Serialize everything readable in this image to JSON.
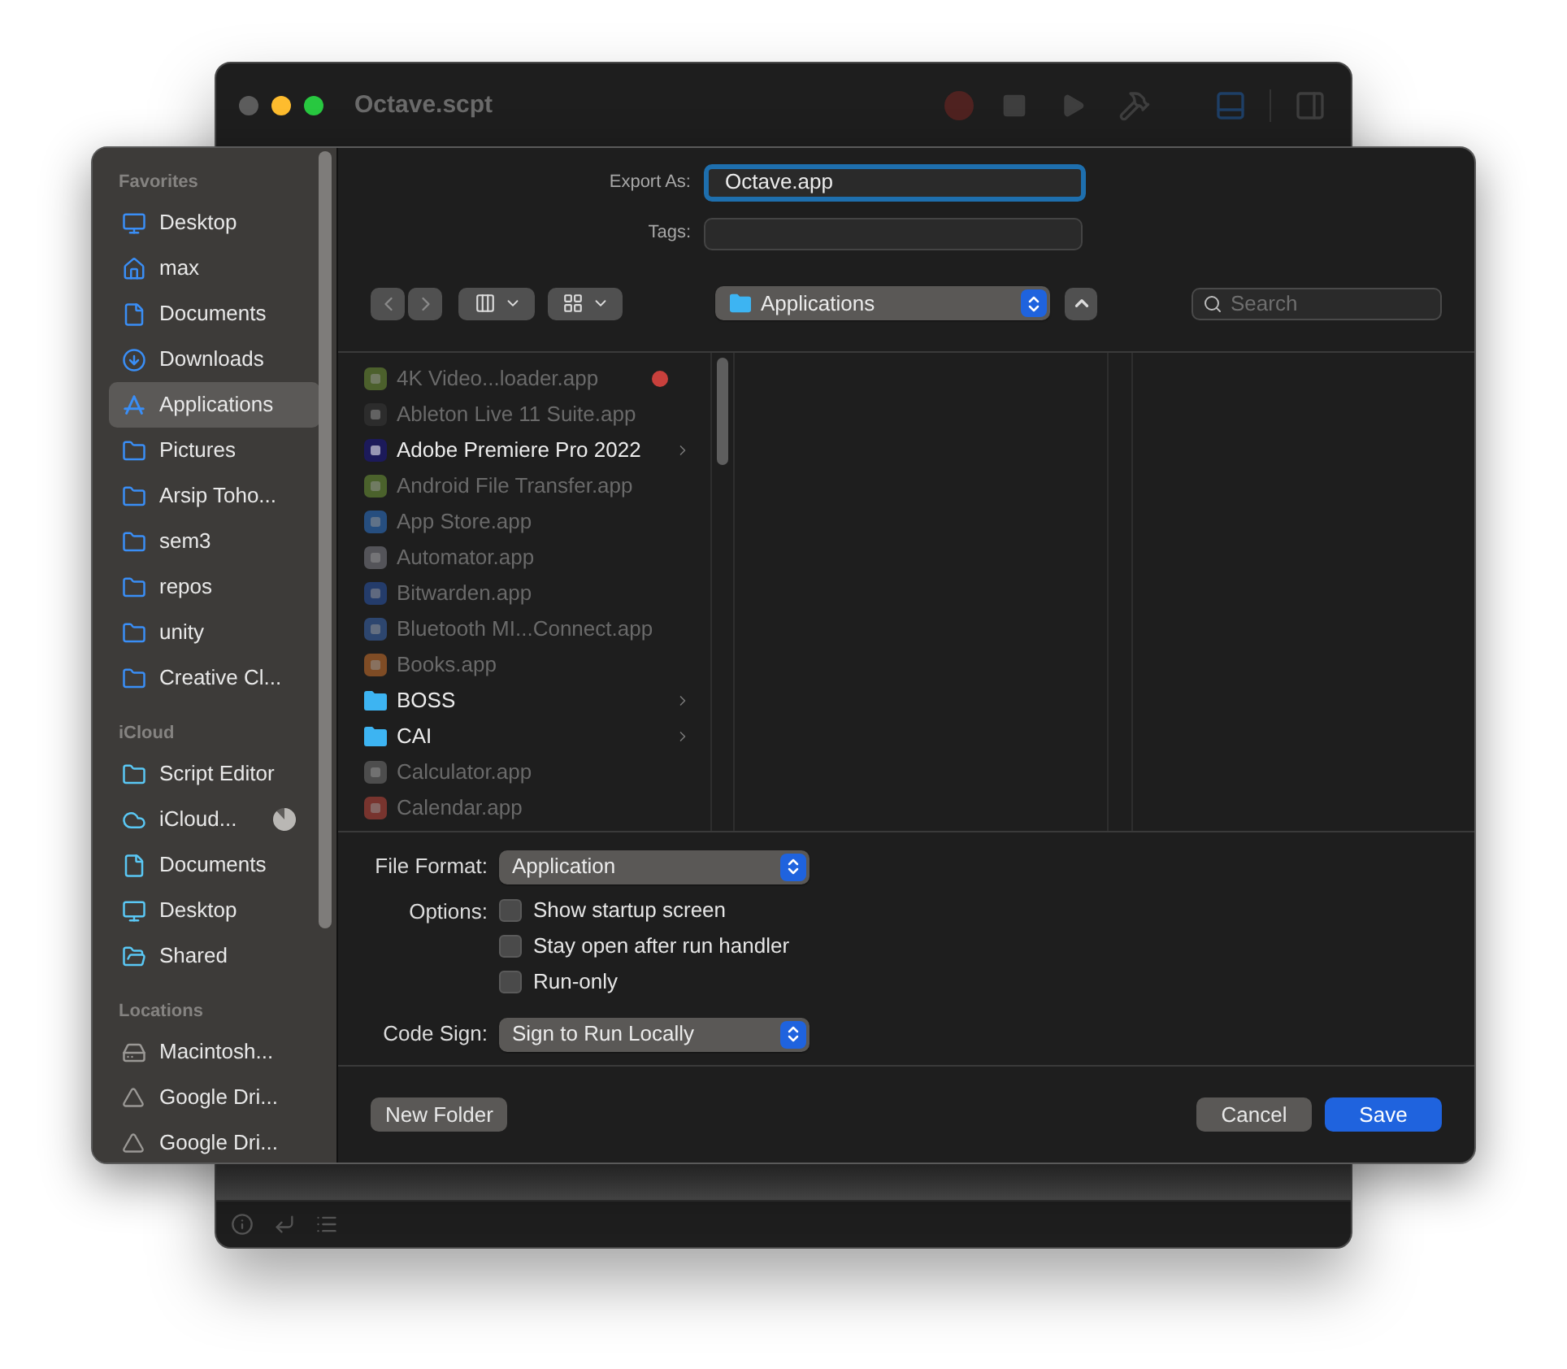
{
  "window": {
    "title": "Octave.scpt"
  },
  "sidebar": {
    "sections": [
      {
        "title": "Favorites",
        "items": [
          {
            "label": "Desktop",
            "kind": "desktop",
            "selected": false
          },
          {
            "label": "max",
            "kind": "home",
            "selected": false
          },
          {
            "label": "Documents",
            "kind": "document",
            "selected": false
          },
          {
            "label": "Downloads",
            "kind": "download",
            "selected": false
          },
          {
            "label": "Applications",
            "kind": "apps",
            "selected": true
          },
          {
            "label": "Pictures",
            "kind": "folder",
            "selected": false
          },
          {
            "label": "Arsip Toho...",
            "kind": "folder",
            "selected": false
          },
          {
            "label": "sem3",
            "kind": "folder",
            "selected": false
          },
          {
            "label": "repos",
            "kind": "folder",
            "selected": false
          },
          {
            "label": "unity",
            "kind": "folder",
            "selected": false
          },
          {
            "label": "Creative Cl...",
            "kind": "folder",
            "selected": false
          }
        ]
      },
      {
        "title": "iCloud",
        "items": [
          {
            "label": "Script Editor",
            "kind": "cloud-folder",
            "selected": false
          },
          {
            "label": "iCloud...",
            "kind": "cloud",
            "selected": false,
            "level": 0.88
          },
          {
            "label": "Documents",
            "kind": "cloud-document",
            "selected": false
          },
          {
            "label": "Desktop",
            "kind": "cloud-desktop",
            "selected": false
          },
          {
            "label": "Shared",
            "kind": "shared",
            "selected": false
          }
        ]
      },
      {
        "title": "Locations",
        "items": [
          {
            "label": "Macintosh...",
            "kind": "drive",
            "selected": false
          },
          {
            "label": "Google Dri...",
            "kind": "gdrive",
            "selected": false
          },
          {
            "label": "Google Dri...",
            "kind": "gdrive",
            "selected": false
          }
        ]
      }
    ]
  },
  "export_as": {
    "label": "Export As:",
    "value": "Octave.app",
    "focused": true
  },
  "tags": {
    "label": "Tags:"
  },
  "location": {
    "value": "Applications"
  },
  "search": {
    "placeholder": "Search"
  },
  "files": [
    {
      "name": "4K Video...loader.app",
      "kind": "app",
      "disabled": true,
      "expandable": false,
      "color": "#c8403c"
    },
    {
      "name": "Ableton Live 11 Suite.app",
      "kind": "app",
      "disabled": true,
      "expandable": false
    },
    {
      "name": "Adobe Premiere Pro 2022",
      "kind": "app",
      "disabled": false,
      "expandable": true
    },
    {
      "name": "Android File Transfer.app",
      "kind": "app",
      "disabled": true,
      "expandable": false
    },
    {
      "name": "App Store.app",
      "kind": "app",
      "disabled": true,
      "expandable": false
    },
    {
      "name": "Automator.app",
      "kind": "app",
      "disabled": true,
      "expandable": false
    },
    {
      "name": "Bitwarden.app",
      "kind": "app",
      "disabled": true,
      "expandable": false
    },
    {
      "name": "Bluetooth MI...Connect.app",
      "kind": "app",
      "disabled": true,
      "expandable": false
    },
    {
      "name": "Books.app",
      "kind": "app",
      "disabled": true,
      "expandable": false
    },
    {
      "name": "BOSS",
      "kind": "folder",
      "disabled": false,
      "expandable": true
    },
    {
      "name": "CAI",
      "kind": "folder",
      "disabled": false,
      "expandable": true
    },
    {
      "name": "Calculator.app",
      "kind": "app",
      "disabled": true,
      "expandable": false
    },
    {
      "name": "Calendar.app",
      "kind": "app",
      "disabled": true,
      "expandable": false
    }
  ],
  "file_format": {
    "label": "File Format:",
    "value": "Application"
  },
  "options": {
    "label": "Options:",
    "items": [
      {
        "label": "Show startup screen",
        "checked": false
      },
      {
        "label": "Stay open after run handler",
        "checked": false
      },
      {
        "label": "Run-only",
        "checked": false
      }
    ]
  },
  "code_sign": {
    "label": "Code Sign:",
    "value": "Sign to Run Locally"
  },
  "buttons": [
    {
      "label": "New Folder",
      "kind": "plain"
    },
    {
      "label": "Cancel",
      "kind": "plain"
    },
    {
      "label": "Save",
      "kind": "default"
    }
  ]
}
